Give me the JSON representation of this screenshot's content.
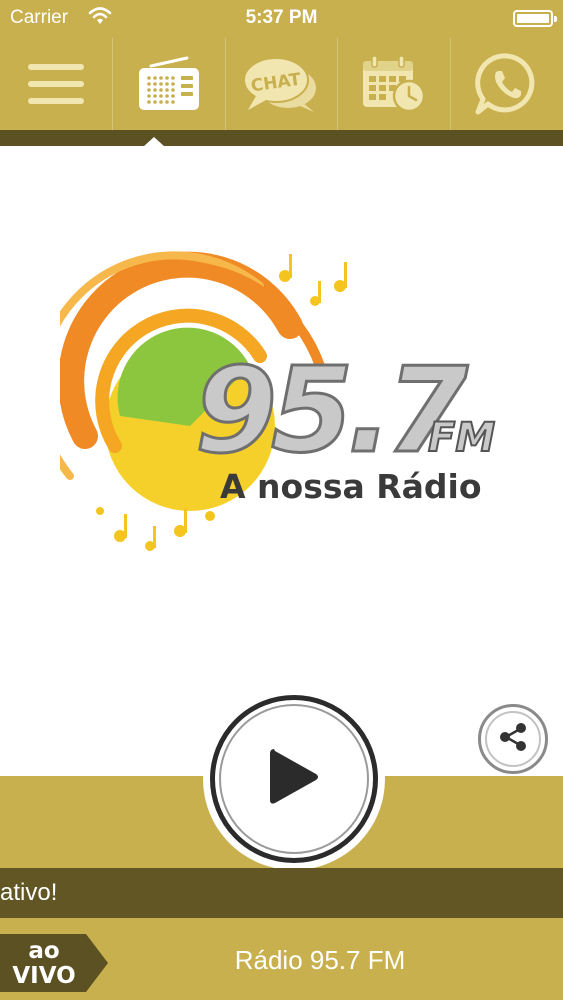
{
  "status_bar": {
    "carrier": "Carrier",
    "time": "5:37 PM"
  },
  "navbar": {
    "items": [
      {
        "name": "menu",
        "icon": "hamburger-menu-icon"
      },
      {
        "name": "radio",
        "icon": "radio-icon",
        "selected": true
      },
      {
        "name": "chat",
        "icon": "chat-bubble-icon",
        "label": "CHAT"
      },
      {
        "name": "schedule",
        "icon": "calendar-clock-icon"
      },
      {
        "name": "whatsapp",
        "icon": "whatsapp-icon"
      }
    ]
  },
  "logo": {
    "number": "95.7",
    "unit": "FM",
    "slogan": "A nossa Rádio"
  },
  "player": {
    "play_icon": "play-icon",
    "share_icon": "share-icon"
  },
  "ticker": {
    "text": "ativo!"
  },
  "footer": {
    "badge_line1": "ao",
    "badge_line2": "VIVO",
    "station_name": "Rádio 95.7 FM"
  },
  "colors": {
    "gold": "#c8b04e",
    "dark_strip": "#5b5122",
    "ticker_bg": "#625724",
    "orange": "#f08a24",
    "yellow": "#f4c51f",
    "green": "#8cc63f"
  }
}
